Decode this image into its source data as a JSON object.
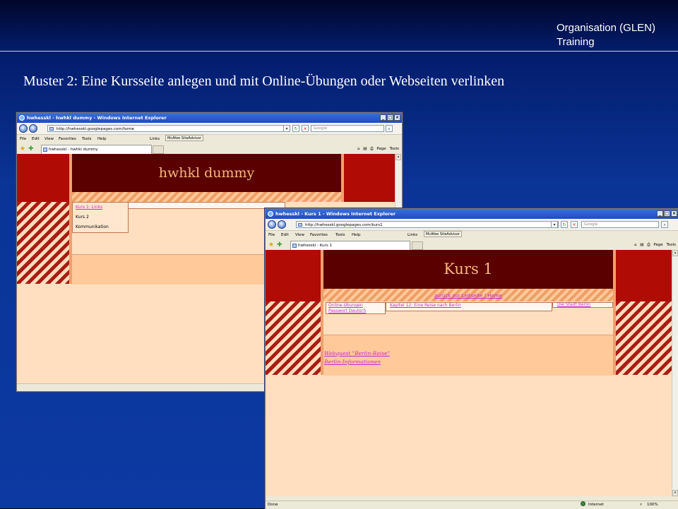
{
  "slide": {
    "header_lines": [
      "Organisation (GLEN)",
      "Training"
    ],
    "title": "Muster 2: Eine Kursseite anlegen und mit Online-Übungen oder Webseiten verlinken"
  },
  "browser_common": {
    "search_placeholder": "Google",
    "menu": [
      "File",
      "Edit",
      "View",
      "Favorites",
      "Tools",
      "Help"
    ],
    "links_label": "Links",
    "toolbar_addon": "McAfee SiteAdvisor",
    "page_menu": "Page",
    "tools_menu": "Tools"
  },
  "window1": {
    "title": "hwhesskl - hwhkl dummy - Windows Internet Explorer",
    "url": "http://hwhesskl.googlepages.com/home",
    "tab": "hwhesskl - hwhkl dummy",
    "site_title": "hwhkl dummy",
    "nav": [
      "Kurs 1: Links",
      "Kurs 2",
      "Kommunikation"
    ]
  },
  "window2": {
    "title": "hwhesskl - Kurs 1 - Windows Internet Explorer",
    "url": "http://hwhesskl.googlepages.com/kurs1",
    "tab": "hwhesskl - Kurs 1",
    "site_title": "Kurs 1",
    "home_link": "zurück zur Leitseite / Home",
    "left_links": [
      "Online-Übungen",
      "Passwort Deutsch"
    ],
    "mid_link": "Kapitel 12: Eine Reise nach Berlin",
    "right_link": "Die Stadt Berlin",
    "bottom_links": [
      "Webquest \"Berlin-Reise\"",
      "Berlin-Informationen"
    ],
    "status_left": "Done",
    "status_zone": "Internet",
    "zoom": "100%"
  }
}
